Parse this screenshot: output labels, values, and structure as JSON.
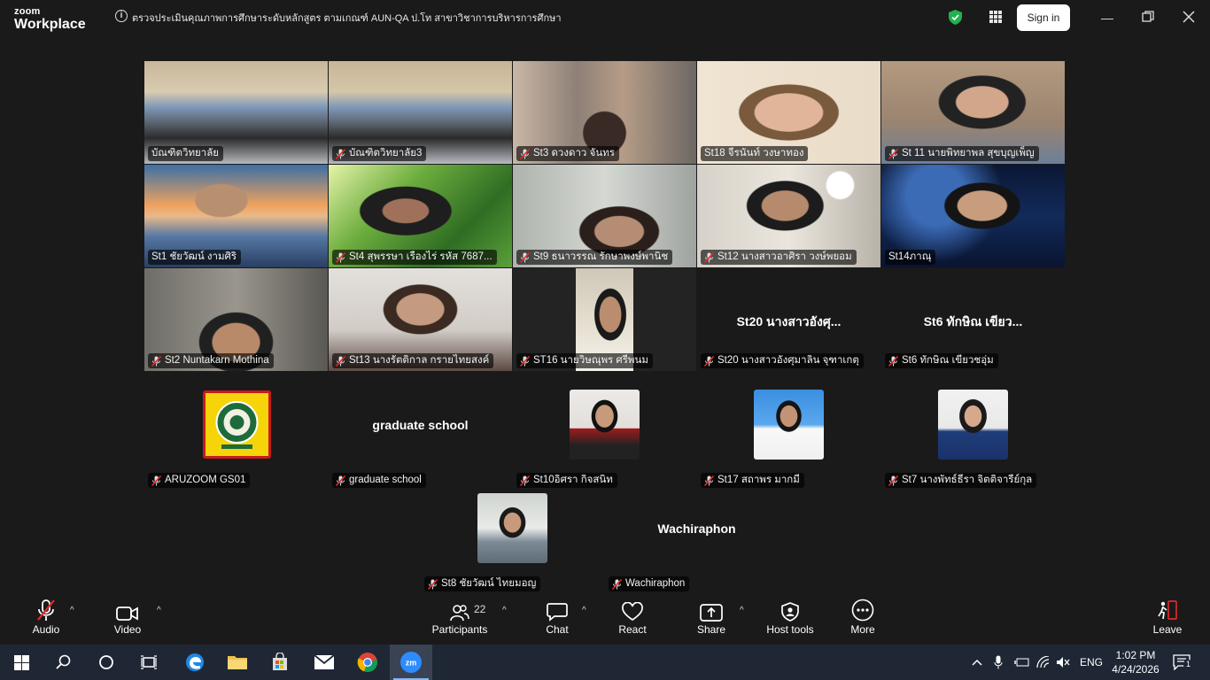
{
  "app": {
    "brand_line1": "zoom",
    "brand_line2": "Workplace",
    "meeting_title": "ตรวจประเมินคุณภาพการศึกษาระดับหลักสูตร ตามเกณฑ์ AUN-QA ป.โท สาขาวิชาการบริหารการศึกษา",
    "signin_label": "Sign in"
  },
  "tiles": [
    {
      "name": "บัณฑิตวิทยาลัย",
      "muted": false
    },
    {
      "name": "บัณฑิตวิทยาลัย3",
      "muted": true
    },
    {
      "name": "St3 ดวงดาว จันทร",
      "muted": true
    },
    {
      "name": "St18 จีรนันท์ วงษาทอง",
      "muted": false
    },
    {
      "name": "St 11 นายพิทยาพล สุขบุญเพ็ญ",
      "muted": true
    },
    {
      "name": "St1 ชัยวัฒน์ งามศิริ",
      "muted": false
    },
    {
      "name": "St4 สุพรรษา เรืองไร่ รหัส 7687...",
      "muted": true
    },
    {
      "name": "St9 ธนาวรรณ รักษาพงษ์พานิช",
      "muted": true
    },
    {
      "name": "St12 นางสาวอาศิรา วงษ์พยอม",
      "muted": true
    },
    {
      "name": "St14ภาณุ",
      "muted": false
    },
    {
      "name": "St2 Nuntakarn Mothina",
      "muted": true
    },
    {
      "name": "St13 นางรัตติกาล กรายไทยสงค์",
      "muted": true
    },
    {
      "name": "ST16 นายวิษณุพร ศรีพนม",
      "muted": true
    },
    {
      "name": "St20 นางสาวอังศุมาลิน จุฑาเกตุ",
      "muted": true,
      "big": "St20 นางสาวอังศุ..."
    },
    {
      "name": "St6 ทักษิณ เขียวชอุ่ม",
      "muted": true,
      "big": "St6 ทักษิณ เขียว..."
    }
  ],
  "row4": [
    {
      "name": "ARUZOOM GS01",
      "muted": true,
      "kind": "logo"
    },
    {
      "name": "graduate school",
      "muted": true,
      "kind": "text",
      "big": "graduate school"
    },
    {
      "name": "St10อิศรา กิจสนิท",
      "muted": true,
      "kind": "photo"
    },
    {
      "name": "St17 สถาพร มากมี",
      "muted": true,
      "kind": "photo"
    },
    {
      "name": "St7 นางพัทธ์ธีรา จิตติจารีย์กุล",
      "muted": true,
      "kind": "photo"
    }
  ],
  "row5": [
    {
      "name": "St8 ชัยวัฒน์ ไทยมอญ",
      "muted": true,
      "kind": "photo"
    },
    {
      "name": "Wachiraphon",
      "muted": true,
      "kind": "text",
      "big": "Wachiraphon"
    }
  ],
  "toolbar": {
    "audio": "Audio",
    "video": "Video",
    "participants": "Participants",
    "participant_count": "22",
    "chat": "Chat",
    "react": "React",
    "share": "Share",
    "host_tools": "Host tools",
    "more": "More",
    "leave": "Leave"
  },
  "taskbar": {
    "lang": "ENG",
    "time": "1:02 PM",
    "date": "4/24/2026",
    "notif": "1"
  },
  "colors": {
    "active_border": "#27c36a",
    "mute_red": "#e02828",
    "leave_red": "#e02828",
    "taskbar_bg": "#1f2735"
  }
}
